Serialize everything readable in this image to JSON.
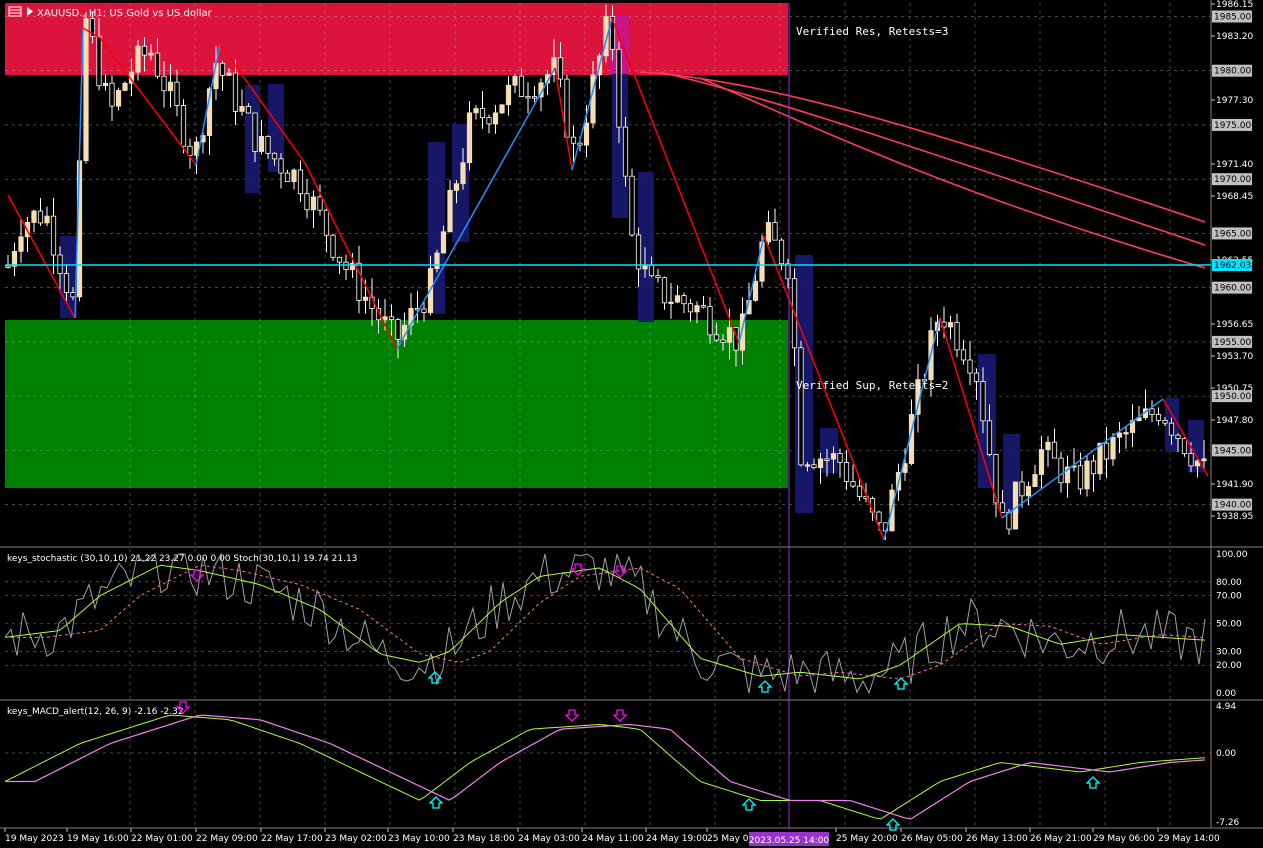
{
  "chart_header": {
    "symbol": "XAUUSD., H1: US Gold vs US dollar"
  },
  "zone_labels": {
    "resistance": "Verified Res, Retests=3",
    "support": "Verified Sup, Retests=2"
  },
  "price_axis": {
    "ticks": [
      "1986.15",
      "1983.20",
      "1977.30",
      "1971.40",
      "1968.45",
      "1962.55",
      "1956.65",
      "1953.70",
      "1950.75",
      "1947.80",
      "1941.90",
      "1938.95"
    ],
    "boxed": [
      "1985.00",
      "1980.00",
      "1975.00",
      "1970.00",
      "1965.00",
      "1960.00",
      "1955.00",
      "1950.00",
      "1945.00",
      "1940.00"
    ],
    "current": "1962.03"
  },
  "stoch_panel": {
    "title": "keys_stochastic (30,10,10) 21.22 23.27 0.00 0.00 Stoch(30,10,1) 19.74 21.13",
    "ticks": [
      "100.00",
      "80.00",
      "70.00",
      "50.00",
      "30.00",
      "20.00",
      "0.00"
    ]
  },
  "macd_panel": {
    "title": "keys_MACD_alert(12, 26, 9) -2.16 -2.32",
    "ticks": [
      "4.94",
      "0.00",
      "-7.26"
    ]
  },
  "time_axis": {
    "labels": [
      "19 May 2023",
      "19 May 16:00",
      "22 May 01:00",
      "22 May 09:00",
      "22 May 17:00",
      "23 May 02:00",
      "23 May 10:00",
      "23 May 18:00",
      "24 May 03:00",
      "24 May 11:00",
      "24 May 19:00",
      "25 May 04:00",
      "25 May 20:00",
      "26 May 05:00",
      "26 May 13:00",
      "26 May 21:00",
      "29 May 06:00",
      "29 May 14:00"
    ],
    "crosshair_label": "2023.05.25 14:00"
  },
  "colors": {
    "background": "#000000",
    "resistance_zone": "#dc143c",
    "support_zone": "#008000",
    "bull_candle": "#f5deb3",
    "bear_candle": "#ffffff",
    "zigzag_up": "#1e90ff",
    "zigzag_down": "#ff0000",
    "current_price_line": "#00e5ff",
    "box_fill": "#191970",
    "crosshair": "#9932cc",
    "arrow_down": "#ff00ff",
    "arrow_up": "#00ffff"
  }
}
